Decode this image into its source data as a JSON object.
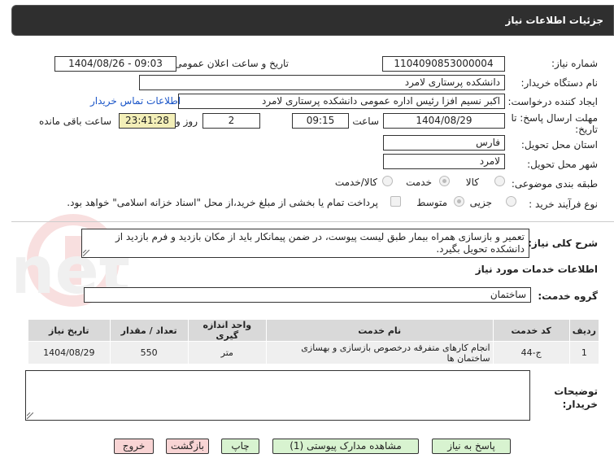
{
  "header": {
    "title": "جزئیات اطلاعات نیاز"
  },
  "fields": {
    "need_number_label": "شماره نیاز:",
    "need_number": "1104090853000004",
    "announce_label": "تاریخ و ساعت اعلان عمومی:",
    "announce_value": "1404/08/26 - 09:03",
    "buyer_org_label": "نام دستگاه خریدار:",
    "buyer_org": "دانشکده پرستاری لامرد",
    "creator_label": "ایجاد کننده درخواست:",
    "creator": "اکبر نسیم افزا رئیس اداره عمومی دانشکده پرستاری لامرد",
    "contact_link": "اطلاعات تماس خریدار",
    "deadline_label_1": "مهلت ارسال پاسخ: تا",
    "deadline_label_2": "تاریخ:",
    "deadline_date": "1404/08/29",
    "time_label": "ساعت",
    "deadline_time": "09:15",
    "days_value": "2",
    "days_label": "روز و",
    "remaining_time": "23:41:28",
    "remaining_label": "ساعت باقی مانده",
    "province_label": "استان محل تحویل:",
    "province": "فارس",
    "city_label": "شهر محل تحویل:",
    "city": "لامرد",
    "category_label": "طبقه بندی موضوعی:",
    "category_options": [
      "کالا",
      "خدمت",
      "کالا/خدمت"
    ],
    "category_selected": "خدمت",
    "process_label": "نوع فرآیند خرید :",
    "process_options": [
      "جزیی",
      "متوسط"
    ],
    "process_selected": "متوسط",
    "payment_note": "پرداخت تمام یا بخشی از مبلغ خرید،از محل \"اسناد خزانه اسلامی\" خواهد بود."
  },
  "details": {
    "summary_label": "شرح کلی نیاز:",
    "summary": "تعمیر و بازسازی همراه بیمار طبق لیست پیوست، در ضمن پیمانکار باید از مکان بازدید و فرم بازدید از دانشکده تحویل بگیرد.",
    "services_heading": "اطلاعات خدمات مورد نیاز",
    "service_group_label": "گروه خدمت:",
    "service_group": "ساختمان",
    "table": {
      "headers": [
        "ردیف",
        "کد خدمت",
        "نام خدمت",
        "واحد اندازه گیری",
        "تعداد / مقدار",
        "تاریخ نیاز"
      ],
      "rows": [
        [
          "1",
          "ج-44",
          "انجام کارهای متفرقه درخصوص بازسازی و بهسازی ساختمان ها",
          "متر",
          "550",
          "1404/08/29"
        ]
      ]
    },
    "buyer_notes_label_1": "توضیحات",
    "buyer_notes_label_2": "خریدار:",
    "buyer_notes": ""
  },
  "buttons": {
    "reply": "پاسخ به نیاز",
    "view_docs": "مشاهده مدارک پیوستی (1)",
    "print": "چاپ",
    "back": "بازگشت",
    "exit": "خروج"
  },
  "colors": {
    "title_bg": "#2f2f2f",
    "yellow_box": "#f3efb8",
    "link": "#1a55c8",
    "green_button": "#d8f3d0",
    "red_button": "#f8d4d4",
    "table_header": "#d9d9d9"
  }
}
